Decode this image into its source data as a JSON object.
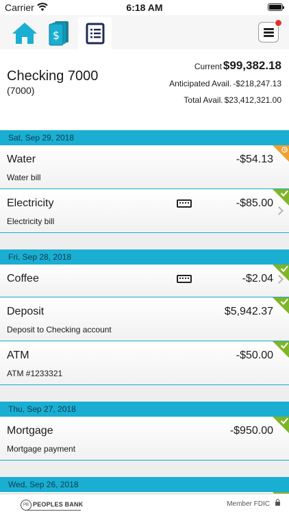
{
  "status_bar": {
    "carrier": "Carrier",
    "time": "6:18 AM"
  },
  "toolbar": {
    "tabs": [
      {
        "name": "home",
        "icon": "home-icon"
      },
      {
        "name": "money",
        "icon": "dollar-cards-icon"
      },
      {
        "name": "register",
        "icon": "register-list-icon",
        "active": true
      }
    ],
    "menu": {
      "icon": "hamburger-menu-icon",
      "has_notification": true
    }
  },
  "account": {
    "name": "Checking 7000",
    "number": "(7000)",
    "current_label": "Current",
    "current_amount": "$99,382.18",
    "anticipated_label": "Anticipated Avail.",
    "anticipated_amount": "-$218,247.13",
    "total_label": "Total Avail.",
    "total_amount": "$23,412,321.00"
  },
  "groups": [
    {
      "date": "Sat, Sep 29, 2018",
      "transactions": [
        {
          "name": "Water",
          "amount": "-$54.13",
          "description": "Water bill",
          "status": "pending"
        },
        {
          "name": "Electricity",
          "amount": "-$85.00",
          "description": "Electricity bill",
          "status": "cleared",
          "has_note": true,
          "has_chevron": true
        }
      ]
    },
    {
      "date": "Fri, Sep 28, 2018",
      "transactions": [
        {
          "name": "Coffee",
          "amount": "-$2.04",
          "description": "",
          "status": "cleared",
          "has_note": true,
          "has_chevron": true
        },
        {
          "name": "Deposit",
          "amount": "$5,942.37",
          "description": "Deposit to Checking account",
          "status": "cleared"
        },
        {
          "name": "ATM",
          "amount": "-$50.00",
          "description": "ATM #1233321",
          "status": "cleared"
        }
      ]
    },
    {
      "date": "Thu, Sep 27, 2018",
      "transactions": [
        {
          "name": "Mortgage",
          "amount": "-$950.00",
          "description": "Mortgage payment",
          "status": "cleared"
        }
      ]
    },
    {
      "date": "Wed, Sep 26, 2018",
      "transactions": []
    }
  ],
  "footer": {
    "bank_name": "PEOPLES BANK",
    "seal_text": "PB",
    "fdic": "Member FDIC"
  },
  "colors": {
    "accent": "#1aaed2",
    "cleared": "#7fb528",
    "pending": "#f0a030",
    "notification": "#e3322e"
  }
}
